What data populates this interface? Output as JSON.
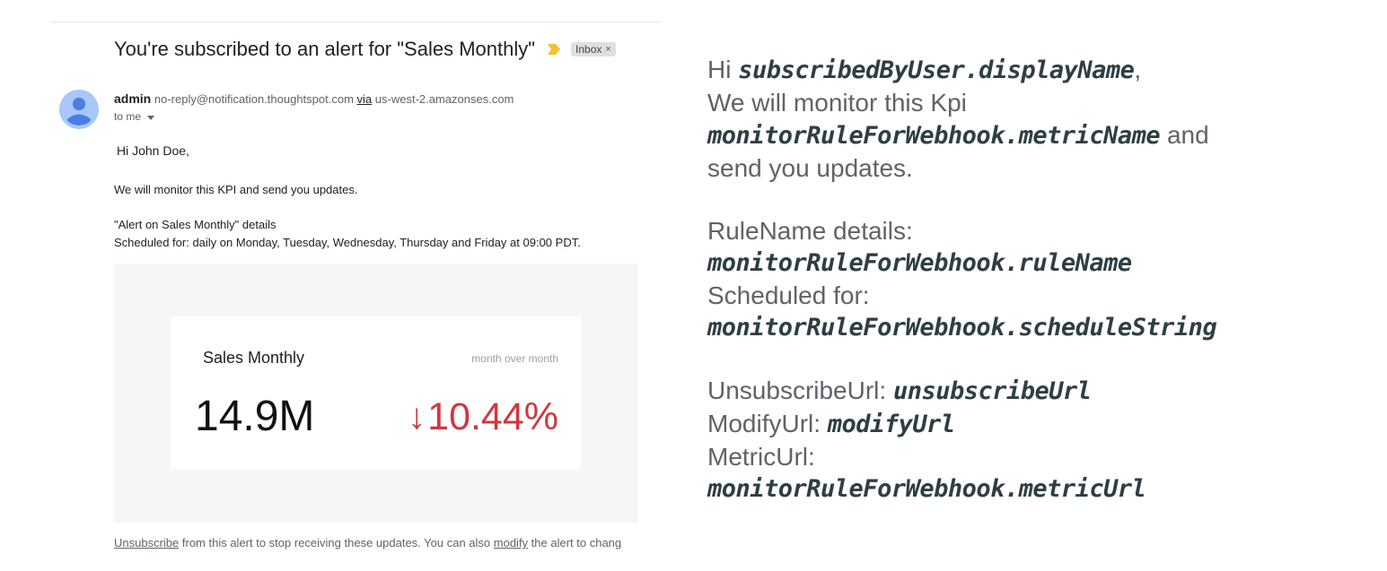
{
  "email": {
    "subject": "You're subscribed to an alert for \"Sales Monthly\"",
    "label_chip": "Inbox",
    "label_close": "×",
    "sender_name": "admin",
    "sender_email": "no-reply@notification.thoughtspot.com",
    "via_label": "via",
    "via_domain": "us-west-2.amazonses.com",
    "to_label": "to me",
    "greeting": "Hi John Doe,",
    "body_line1": "We will monitor this KPI and send you updates.",
    "details_line": "\"Alert on Sales Monthly\" details",
    "schedule_line": "Scheduled for: daily on Monday, Tuesday, Wednesday, Thursday and Friday at 09:00 PDT.",
    "kpi": {
      "name": "Sales Monthly",
      "comparison": "month over month",
      "value": "14.9M",
      "change_arrow": "↓",
      "change": "10.44%",
      "change_color": "#d0373d"
    },
    "footer": {
      "unsubscribe_link": "Unsubscribe",
      "text_a": " from this alert to stop receiving these updates. You can also ",
      "modify_link": "modify",
      "text_b": " the alert to chang"
    }
  },
  "template": {
    "hi": "Hi ",
    "display_name_var": "subscribedByUser.displayName",
    "comma": ",",
    "monitor_line": "We will monitor this Kpi",
    "metric_name_var": "monitorRuleForWebhook.metricName",
    "and_text": " and",
    "send_updates": "send you updates.",
    "rule_details_label": "RuleName details:",
    "rule_name_var": "monitorRuleForWebhook.ruleName",
    "scheduled_label": "Scheduled for:",
    "schedule_var": "monitorRuleForWebhook.scheduleString",
    "unsubscribe_label": "UnsubscribeUrl: ",
    "unsubscribe_var": "unsubscribeUrl",
    "modify_label": "ModifyUrl: ",
    "modify_var": "modifyUrl",
    "metric_url_label": "MetricUrl:",
    "metric_url_var": "monitorRuleForWebhook.metricUrl"
  },
  "colors": {
    "accent_importance": "#f1c232",
    "avatar": "#a8c7fa"
  }
}
